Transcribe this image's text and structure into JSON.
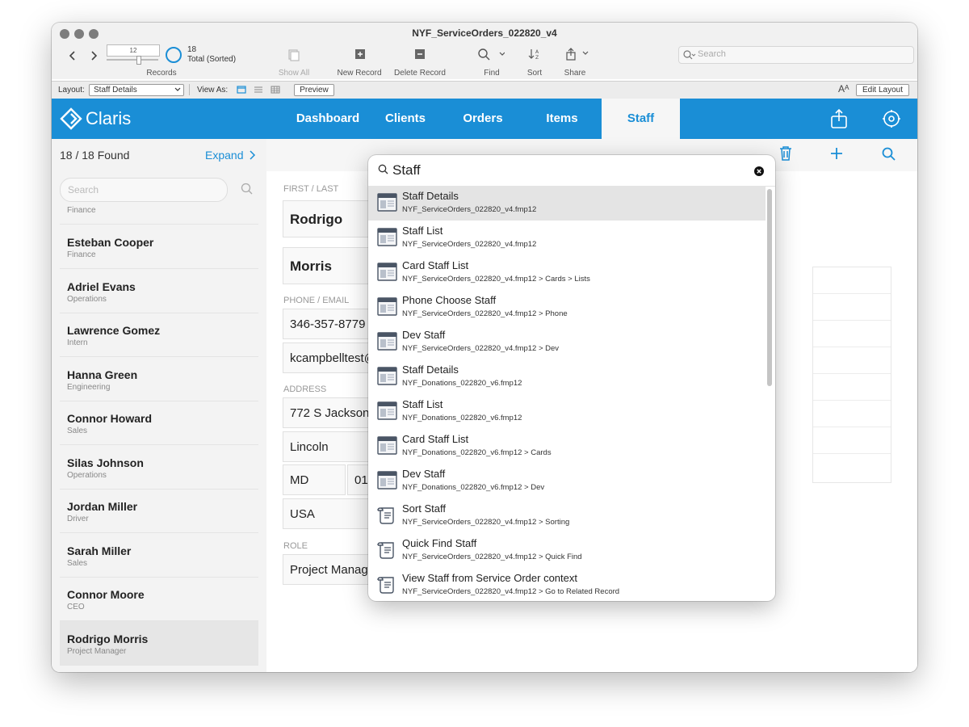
{
  "window": {
    "title": "NYF_ServiceOrders_022820_v4"
  },
  "toolbar": {
    "record_value": "12",
    "records_total": "18",
    "records_status": "Total (Sorted)",
    "records_label": "Records",
    "show_all": "Show All",
    "new_record": "New Record",
    "delete_record": "Delete Record",
    "find": "Find",
    "sort": "Sort",
    "share": "Share",
    "search_placeholder": "Search"
  },
  "layout_bar": {
    "layout_label": "Layout:",
    "layout_value": "Staff Details",
    "view_as": "View As:",
    "preview": "Preview",
    "edit_layout": "Edit Layout"
  },
  "nav": {
    "brand": "Claris",
    "tabs": [
      "Dashboard",
      "Clients",
      "Orders",
      "Items",
      "Staff"
    ],
    "active_tab": "Staff"
  },
  "sidebar": {
    "found": "18 / 18 Found",
    "expand": "Expand",
    "search_placeholder": "Search",
    "partial_dept": "Finance",
    "items": [
      {
        "name": "Esteban Cooper",
        "dept": "Finance"
      },
      {
        "name": "Adriel Evans",
        "dept": "Operations"
      },
      {
        "name": "Lawrence Gomez",
        "dept": "Intern"
      },
      {
        "name": "Hanna Green",
        "dept": "Engineering"
      },
      {
        "name": "Connor Howard",
        "dept": "Sales"
      },
      {
        "name": "Silas Johnson",
        "dept": "Operations"
      },
      {
        "name": "Jordan Miller",
        "dept": "Driver"
      },
      {
        "name": "Sarah Miller",
        "dept": "Sales"
      },
      {
        "name": "Connor Moore",
        "dept": "CEO"
      },
      {
        "name": "Rodrigo Morris",
        "dept": "Project Manager"
      }
    ]
  },
  "record": {
    "first_last_label": "FIRST / LAST",
    "first": "Rodrigo",
    "last": "Morris",
    "phone_email_label": "PHONE / EMAIL",
    "phone": "346-357-8779",
    "email": "kcampbelltest@",
    "address_label": "ADDRESS",
    "street": "772 S Jackson",
    "city": "Lincoln",
    "state": "MD",
    "zip": "01",
    "country": "USA",
    "role_label": "ROLE",
    "role": "Project Manage"
  },
  "quick_open": {
    "query": "Staff",
    "results": [
      {
        "title": "Staff Details",
        "path": "NYF_ServiceOrders_022820_v4.fmp12",
        "kind": "layout"
      },
      {
        "title": "Staff List",
        "path": "NYF_ServiceOrders_022820_v4.fmp12",
        "kind": "layout"
      },
      {
        "title": "Card Staff List",
        "path": "NYF_ServiceOrders_022820_v4.fmp12 > Cards > Lists",
        "kind": "layout"
      },
      {
        "title": "Phone Choose Staff",
        "path": "NYF_ServiceOrders_022820_v4.fmp12 > Phone",
        "kind": "layout"
      },
      {
        "title": "Dev Staff",
        "path": "NYF_ServiceOrders_022820_v4.fmp12 > Dev",
        "kind": "layout"
      },
      {
        "title": "Staff Details",
        "path": "NYF_Donations_022820_v6.fmp12",
        "kind": "layout"
      },
      {
        "title": "Staff List",
        "path": "NYF_Donations_022820_v6.fmp12",
        "kind": "layout"
      },
      {
        "title": "Card Staff List",
        "path": "NYF_Donations_022820_v6.fmp12 > Cards",
        "kind": "layout"
      },
      {
        "title": "Dev Staff",
        "path": "NYF_Donations_022820_v6.fmp12 > Dev",
        "kind": "layout"
      },
      {
        "title": "Sort Staff",
        "path": "NYF_ServiceOrders_022820_v4.fmp12 > Sorting",
        "kind": "script"
      },
      {
        "title": "Quick Find Staff",
        "path": "NYF_ServiceOrders_022820_v4.fmp12 > Quick Find",
        "kind": "script"
      },
      {
        "title": "View Staff from Service Order context",
        "path": "NYF_ServiceOrders_022820_v4.fmp12 > Go to Related Record",
        "kind": "script"
      }
    ]
  },
  "colors": {
    "accent": "#1a8ed6",
    "nav_bg": "#1a8ed6",
    "highlight": "#e4e4e4"
  },
  "icons": {
    "toolbar": [
      "back-icon",
      "forward-icon",
      "pie-icon",
      "show-all-icon",
      "new-record-icon",
      "delete-record-icon",
      "find-icon",
      "sort-icon",
      "share-icon",
      "search-icon",
      "text-size-icon"
    ],
    "nav": [
      "claris-logo-icon",
      "share-icon",
      "settings-icon"
    ],
    "actions": [
      "trash-icon",
      "plus-icon",
      "search-icon"
    ],
    "results": [
      "layout-icon",
      "script-icon"
    ]
  }
}
